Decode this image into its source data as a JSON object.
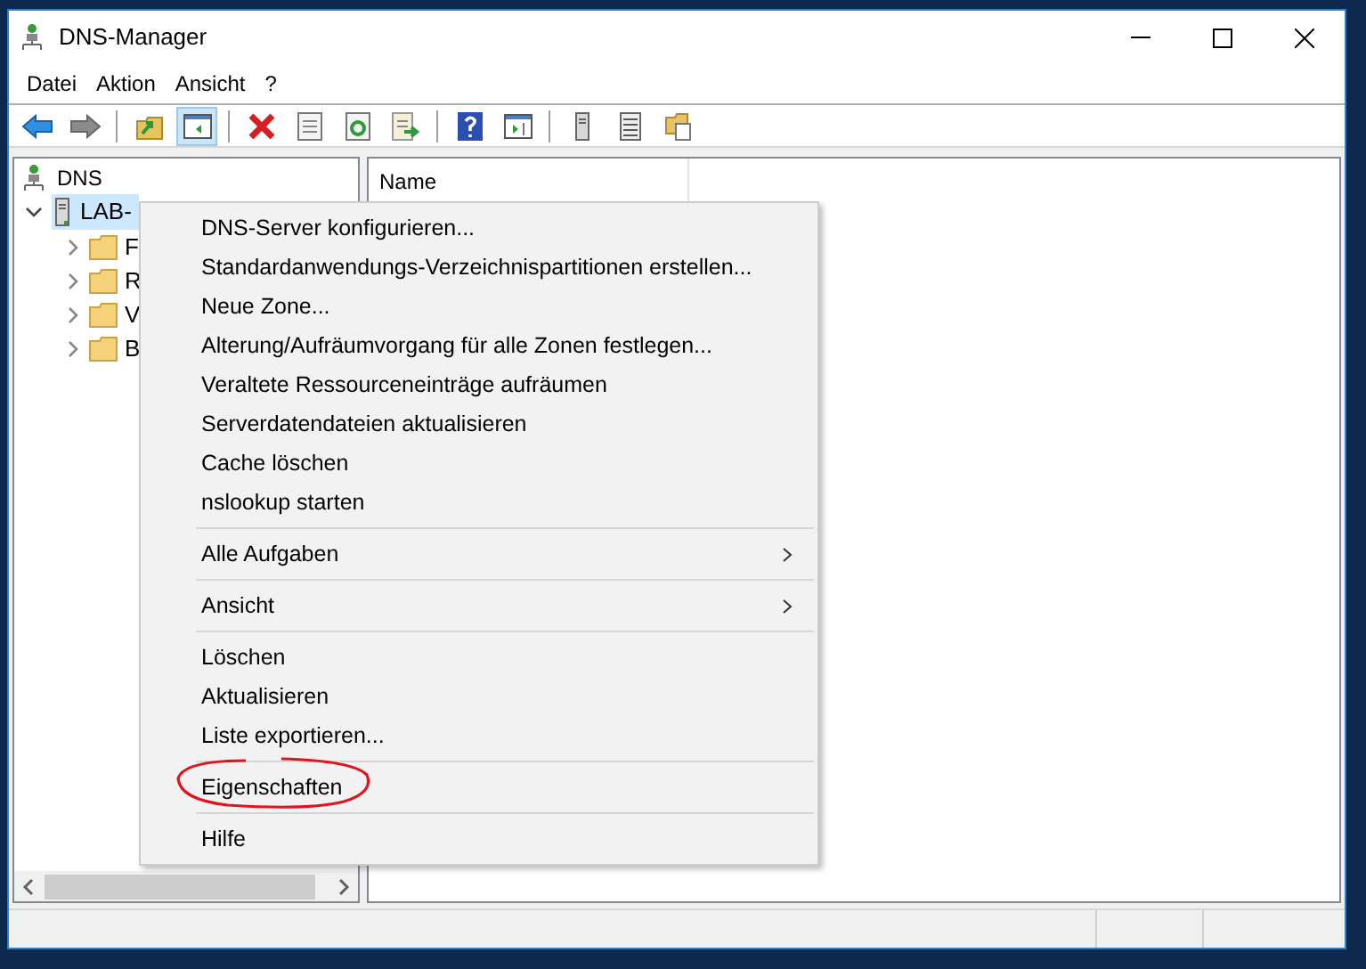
{
  "window": {
    "title": "DNS-Manager"
  },
  "menu_bar": [
    "Datei",
    "Aktion",
    "Ansicht",
    "?"
  ],
  "toolbar": [
    {
      "kind": "back"
    },
    {
      "kind": "forward"
    },
    {
      "kind": "separator"
    },
    {
      "kind": "up"
    },
    {
      "kind": "tree",
      "pressed": true
    },
    {
      "kind": "separator"
    },
    {
      "kind": "delete"
    },
    {
      "kind": "properties"
    },
    {
      "kind": "refresh"
    },
    {
      "kind": "export"
    },
    {
      "kind": "separator"
    },
    {
      "kind": "help"
    },
    {
      "kind": "panel"
    },
    {
      "kind": "separator"
    },
    {
      "kind": "server"
    },
    {
      "kind": "list"
    },
    {
      "kind": "folders"
    }
  ],
  "tree": {
    "label": "DNS",
    "children": [
      {
        "label": "LAB-",
        "expanded": true,
        "selected": true,
        "children": [
          {
            "label": "F",
            "expanded": false,
            "selected": false
          },
          {
            "label": "R",
            "expanded": false,
            "selected": false
          },
          {
            "label": "V",
            "expanded": false,
            "selected": false
          },
          {
            "label": "B",
            "expanded": false,
            "selected": false
          }
        ]
      }
    ]
  },
  "list": {
    "columns": [
      "Name"
    ]
  },
  "context_menu": {
    "groups": [
      [
        {
          "label": "DNS-Server konfigurieren...",
          "kind": "command"
        },
        {
          "label": "Standardanwendungs-Verzeichnispartitionen erstellen...",
          "kind": "command"
        },
        {
          "label": "Neue Zone...",
          "kind": "command"
        },
        {
          "label": "Alterung/Aufräumvorgang für alle Zonen festlegen...",
          "kind": "command"
        },
        {
          "label": "Veraltete Ressourceneinträge aufräumen",
          "kind": "command"
        },
        {
          "label": "Serverdatendateien aktualisieren",
          "kind": "command"
        },
        {
          "label": "Cache löschen",
          "kind": "command"
        },
        {
          "label": "nslookup starten",
          "kind": "command"
        }
      ],
      [
        {
          "label": "Alle Aufgaben",
          "kind": "submenu"
        }
      ],
      [
        {
          "label": "Ansicht",
          "kind": "submenu"
        }
      ],
      [
        {
          "label": "Löschen",
          "kind": "command"
        },
        {
          "label": "Aktualisieren",
          "kind": "command"
        },
        {
          "label": "Liste exportieren...",
          "kind": "command"
        }
      ],
      [
        {
          "label": "Eigenschaften",
          "kind": "command",
          "circled": true
        }
      ],
      [
        {
          "label": "Hilfe",
          "kind": "command"
        }
      ]
    ]
  }
}
